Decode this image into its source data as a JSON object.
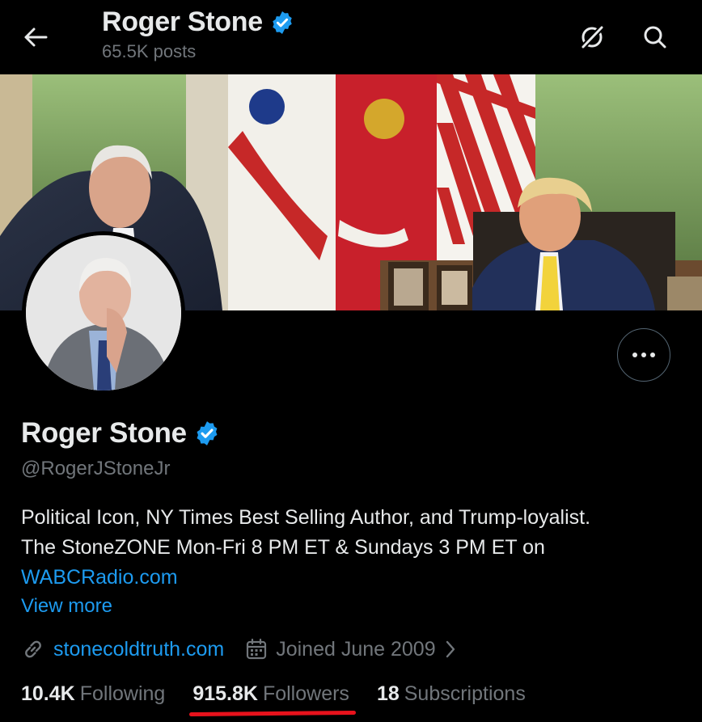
{
  "header": {
    "title": "Roger Stone",
    "posts": "65.5K posts"
  },
  "profile": {
    "name": "Roger Stone",
    "handle": "@RogerJStoneJr",
    "bio_line1": "Political Icon, NY Times Best Selling Author, and Trump-loyalist.",
    "bio_line2": "The StoneZONE Mon-Fri 8 PM ET & Sundays 3 PM ET on",
    "bio_link": "WABCRadio.com",
    "view_more": "View more",
    "website": "stonecoldtruth.com",
    "joined": "Joined June 2009"
  },
  "stats": {
    "following_count": "10.4K",
    "following_label": "Following",
    "followers_count": "915.8K",
    "followers_label": "Followers",
    "subscriptions_count": "18",
    "subscriptions_label": "Subscriptions"
  },
  "colors": {
    "background": "#000000",
    "text": "#e7e9ea",
    "muted": "#71767b",
    "accent": "#1d9bf0",
    "verified": "#1d9bf0",
    "underline": "#e8121c"
  },
  "icons": {
    "back": "arrow-left-icon",
    "grok": "grok-icon",
    "search": "search-icon",
    "verified": "verified-badge-icon",
    "more": "more-horizontal-icon",
    "link": "link-icon",
    "calendar": "calendar-icon",
    "chevron": "chevron-right-icon"
  }
}
